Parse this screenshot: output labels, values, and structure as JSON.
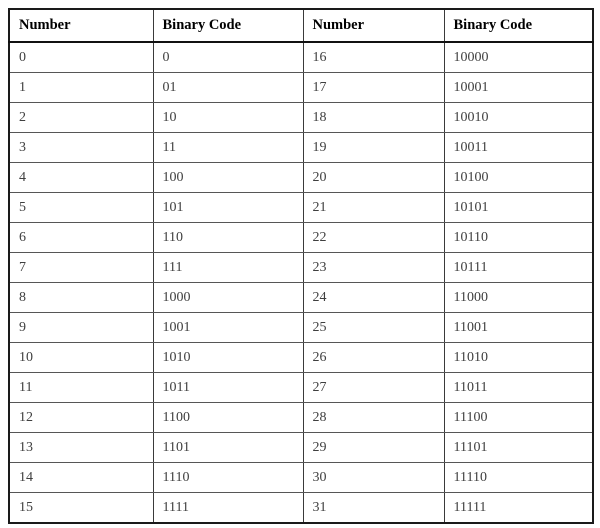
{
  "table": {
    "headers": [
      "Number",
      "Binary Code",
      "Number",
      "Binary Code"
    ],
    "rows": [
      [
        "0",
        "0",
        "16",
        "10000"
      ],
      [
        "1",
        "01",
        "17",
        "10001"
      ],
      [
        "2",
        "10",
        "18",
        "10010"
      ],
      [
        "3",
        "11",
        "19",
        "10011"
      ],
      [
        "4",
        "100",
        "20",
        "10100"
      ],
      [
        "5",
        "101",
        "21",
        "10101"
      ],
      [
        "6",
        "110",
        "22",
        "10110"
      ],
      [
        "7",
        "111",
        "23",
        "10111"
      ],
      [
        "8",
        "1000",
        "24",
        "11000"
      ],
      [
        "9",
        "1001",
        "25",
        "11001"
      ],
      [
        "10",
        "1010",
        "26",
        "11010"
      ],
      [
        "11",
        "1011",
        "27",
        "11011"
      ],
      [
        "12",
        "1100",
        "28",
        "11100"
      ],
      [
        "13",
        "1101",
        "29",
        "11101"
      ],
      [
        "14",
        "1110",
        "30",
        "11110"
      ],
      [
        "15",
        "1111",
        "31",
        "11111"
      ]
    ]
  },
  "colors": {
    "page_background": "#ffffff",
    "table_background": "#ffffff",
    "outer_border": "#1a1a1a",
    "inner_border": "#565656",
    "header_text": "#000000",
    "body_text": "#3f3f3f"
  }
}
